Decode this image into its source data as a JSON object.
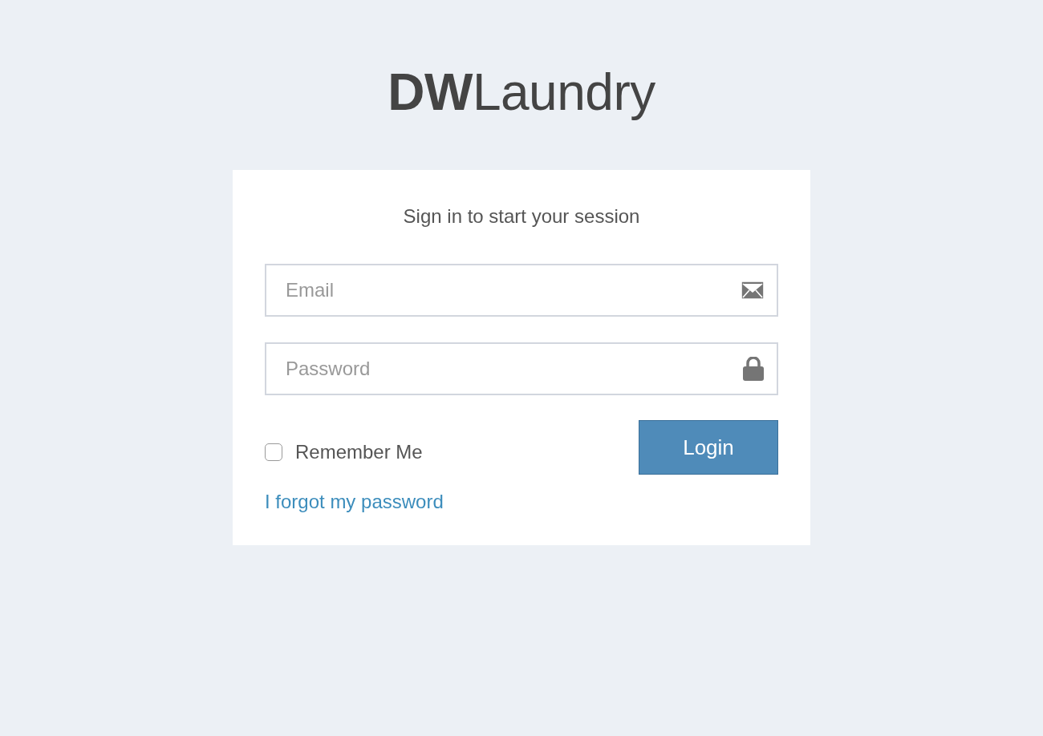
{
  "logo": "**DW**Laundry",
  "login_box": {
    "title": "Sign in to start your session",
    "fields": [
      {
        "kind": "email",
        "placeholder": "Email"
      },
      {
        "kind": "password",
        "placeholder": "Password"
      }
    ],
    "remember": {
      "label": "Remember Me",
      "checked": false
    },
    "button": "Login",
    "forgot_link": "I forgot my password"
  }
}
